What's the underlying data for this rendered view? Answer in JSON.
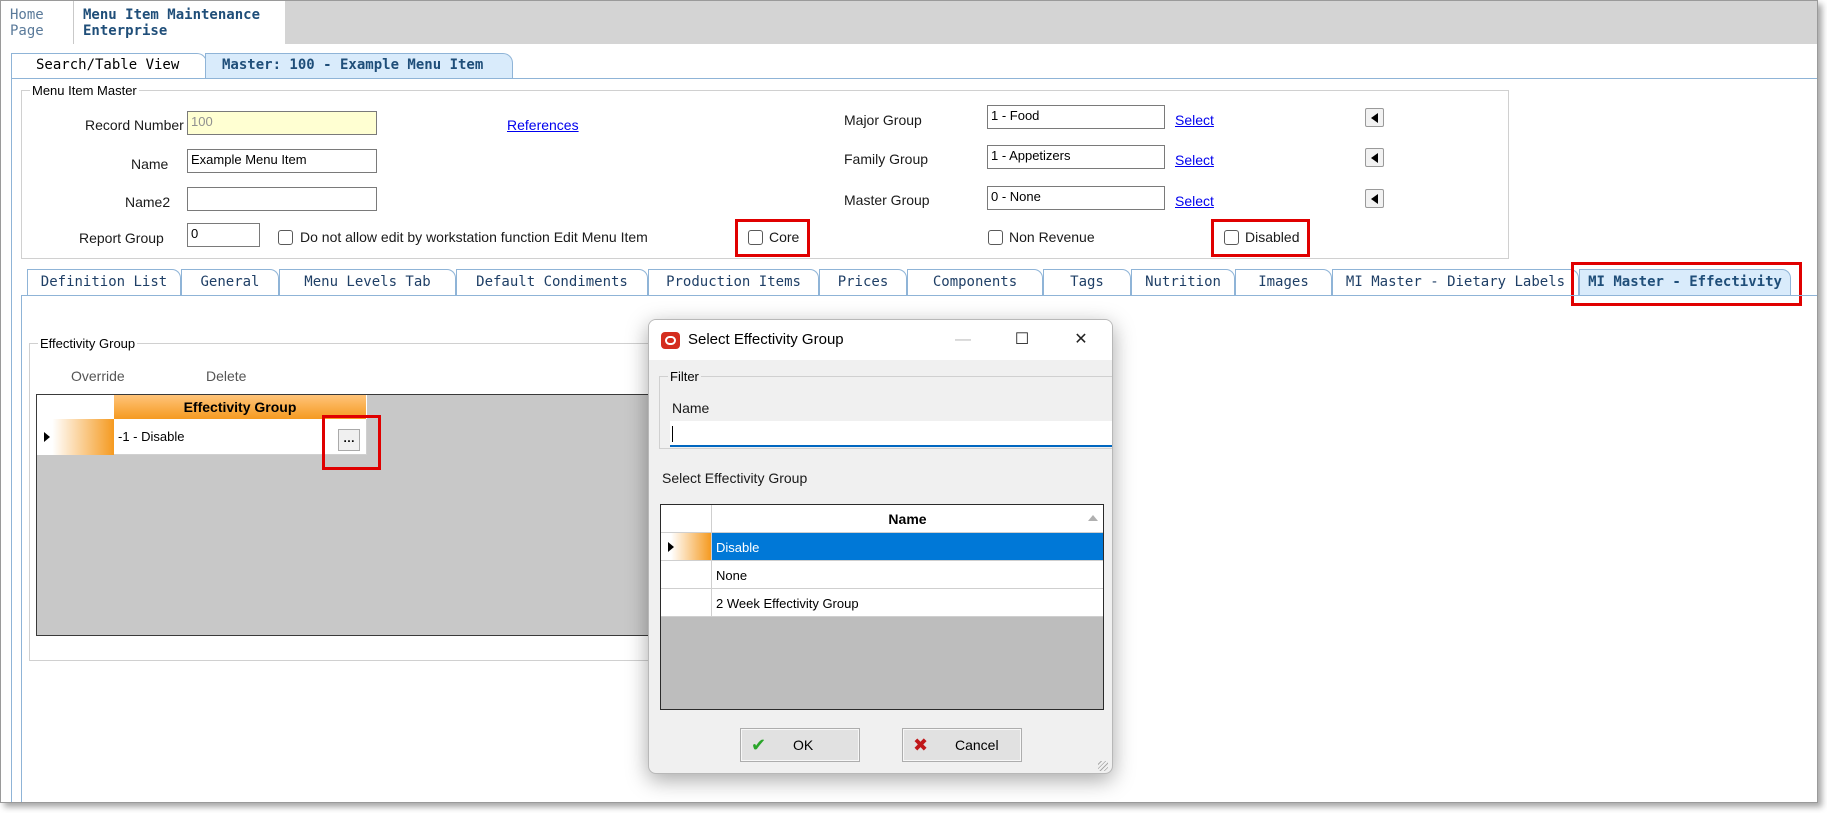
{
  "top_tabs": {
    "home_line1": "Home",
    "home_line2": "Page",
    "mim_line1": "Menu Item Maintenance",
    "mim_line2": "Enterprise"
  },
  "view_tabs": {
    "search": "Search/Table View",
    "master": "Master: 100 - Example Menu Item"
  },
  "master": {
    "legend": "Menu Item Master",
    "record_number_label": "Record Number",
    "record_number": "100",
    "name_label": "Name",
    "name": "Example Menu Item",
    "name2_label": "Name2",
    "name2": "",
    "report_group_label": "Report Group",
    "report_group": "0",
    "no_edit_label": "Do not allow edit by workstation function Edit Menu Item",
    "references_link": "References",
    "core_label": "Core",
    "major_group_label": "Major Group",
    "major_group": "1 - Food",
    "family_group_label": "Family Group",
    "family_group": "1 - Appetizers",
    "master_group_label": "Master Group",
    "master_group": "0 - None",
    "select_link": "Select",
    "non_revenue_label": "Non Revenue",
    "disabled_label": "Disabled"
  },
  "detail_tabs": [
    "Definition List",
    "General",
    "Menu Levels Tab",
    "Default Condiments",
    "Production Items",
    "Prices",
    "Components",
    "Tags",
    "Nutrition",
    "Images",
    "MI Master - Dietary Labels",
    "MI Master - Effectivity"
  ],
  "effectivity": {
    "legend": "Effectivity Group",
    "override_label": "Override",
    "delete_label": "Delete",
    "column_header": "Effectivity Group",
    "rows": [
      "-1 - Disable"
    ],
    "ellipsis": "…"
  },
  "dialog": {
    "title": "Select Effectivity Group",
    "filter_legend": "Filter",
    "name_label": "Name",
    "name_value": "",
    "select_label": "Select Effectivity Group",
    "column_header": "Name",
    "rows": [
      "Disable",
      "None",
      "2 Week Effectivity Group"
    ],
    "selected_index": 0,
    "ok_label": "OK",
    "cancel_label": "Cancel"
  },
  "colors": {
    "highlight_red": "#e00000",
    "selected_row_blue": "#0078d7",
    "grid_header_orange": "#f59a20",
    "active_tab_blue": "#d9ebfb"
  }
}
